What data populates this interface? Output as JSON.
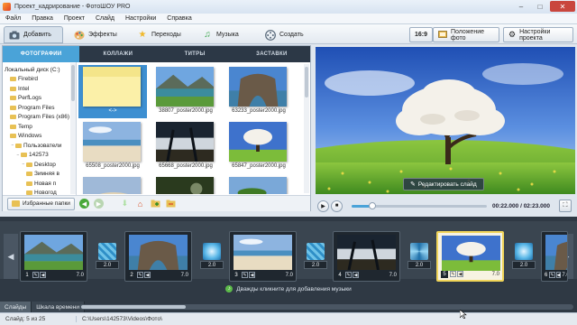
{
  "window": {
    "title": "Проект_кадрирование - ФотоШОУ PRO",
    "controls": [
      "–",
      "□",
      "✕"
    ]
  },
  "menu": [
    "Файл",
    "Правка",
    "Проект",
    "Слайд",
    "Настройки",
    "Справка"
  ],
  "toolbar": {
    "tabs": [
      {
        "label": "Добавить",
        "icon": "camera-icon",
        "active": true
      },
      {
        "label": "Эффекты",
        "icon": "palette-icon"
      },
      {
        "label": "Переходы",
        "icon": "star-icon"
      },
      {
        "label": "Музыка",
        "icon": "music-note-icon"
      },
      {
        "label": "Создать",
        "icon": "film-reel-icon"
      }
    ],
    "aspect_label": "16:9",
    "photo_position_label": "Положение фото",
    "project_settings_label": "Настройки проекта"
  },
  "library": {
    "subtabs": [
      {
        "label": "ФОТОГРАФИИ",
        "active": true
      },
      {
        "label": "КОЛЛАЖИ"
      },
      {
        "label": "ТИТРЫ"
      },
      {
        "label": "ЗАСТАВКИ"
      }
    ],
    "tree": [
      {
        "label": "Локальный диск (C:)",
        "indent": 0,
        "icon": "none"
      },
      {
        "label": "Firebird",
        "indent": 1,
        "icon": "folder"
      },
      {
        "label": "Intel",
        "indent": 1,
        "icon": "folder"
      },
      {
        "label": "PerfLogs",
        "indent": 1,
        "icon": "folder"
      },
      {
        "label": "Program Files",
        "indent": 1,
        "icon": "folder"
      },
      {
        "label": "Program Files (x86)",
        "indent": 1,
        "icon": "folder"
      },
      {
        "label": "Temp",
        "indent": 1,
        "icon": "folder"
      },
      {
        "label": "Windows",
        "indent": 1,
        "icon": "folder"
      },
      {
        "label": "Пользователи",
        "indent": 1,
        "icon": "folder",
        "expand": "−"
      },
      {
        "label": "142573",
        "indent": 2,
        "icon": "folder",
        "expand": "−"
      },
      {
        "label": "Desktop",
        "indent": 3,
        "icon": "folder",
        "expand": "−"
      },
      {
        "label": "Зимняя в",
        "indent": 4,
        "icon": "folder"
      },
      {
        "label": "Новая п",
        "indent": 4,
        "icon": "folder"
      },
      {
        "label": "Новогод",
        "indent": 4,
        "icon": "folder"
      }
    ],
    "photos": [
      {
        "caption": "<->",
        "thumb": "sticky-note",
        "selected": true
      },
      {
        "caption": "38807_poster2000.jpg",
        "thumb": "mountain-lake"
      },
      {
        "caption": "63233_poster2000.jpg",
        "thumb": "rock-arch"
      },
      {
        "caption": "65508_poster2000.jpg",
        "thumb": "beach"
      },
      {
        "caption": "65668_poster2000.jpg",
        "thumb": "palms"
      },
      {
        "caption": "65847_poster2000.jpg",
        "thumb": "tree-field"
      },
      {
        "caption": "",
        "thumb": "sand-dune"
      },
      {
        "caption": "",
        "thumb": "dark-forest"
      },
      {
        "caption": "",
        "thumb": "green-field"
      }
    ],
    "favorites_label": "Избранные папки"
  },
  "preview": {
    "edit_slide_label": "Редактировать слайд"
  },
  "player": {
    "time": "00:22.000 / 02:23.000",
    "progress": 0.15
  },
  "timeline": {
    "slides": [
      {
        "num": "1",
        "duration": "7.0",
        "thumb": "mountain-lake",
        "selected": false
      },
      {
        "num": "2",
        "duration": "7.0",
        "thumb": "rock-arch",
        "selected": false
      },
      {
        "num": "3",
        "duration": "7.0",
        "thumb": "beach",
        "selected": false
      },
      {
        "num": "4",
        "duration": "7.0",
        "thumb": "palms",
        "selected": false
      },
      {
        "num": "5",
        "duration": "7.0",
        "thumb": "tree-field",
        "selected": true
      },
      {
        "num": "6",
        "duration": "7.0",
        "thumb": "rock-arch",
        "selected": false
      }
    ],
    "transitions": [
      {
        "duration": "2.0",
        "style": "mosaic"
      },
      {
        "duration": "2.0",
        "style": "glow"
      },
      {
        "duration": "2.0",
        "style": "mosaic"
      },
      {
        "duration": "2.0",
        "style": "swirl"
      },
      {
        "duration": "2.0",
        "style": "glow"
      }
    ],
    "music_hint": "Дважды кликните для добавления музыки",
    "tabs": [
      {
        "label": "Слайды",
        "active": true
      },
      {
        "label": "Шкала времени"
      }
    ]
  },
  "status": {
    "count": "Слайд: 5 из 25",
    "path": "C:\\Users\\142573\\Videos\\Фото\\"
  }
}
